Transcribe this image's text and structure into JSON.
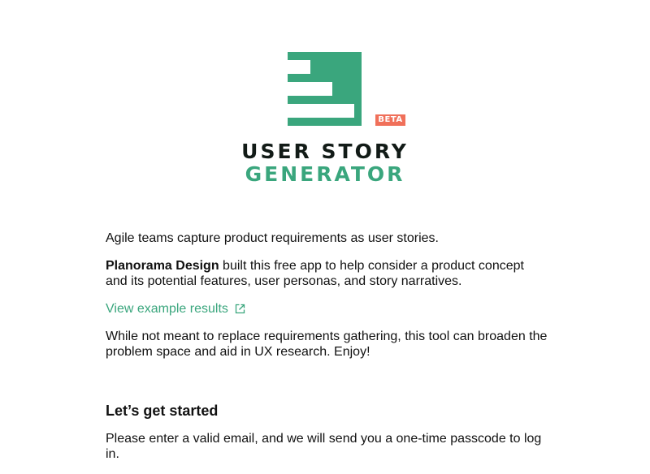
{
  "logo": {
    "badge": "BETA",
    "title_line1": "USER STORY",
    "title_line2": "GENERATOR",
    "brand_color": "#3aa67d",
    "badge_color": "#f0705a",
    "icon": "bars-logo-icon"
  },
  "intro": {
    "line1": "Agile teams capture product requirements as user stories.",
    "company_name": "Planorama Design",
    "line2_rest": " built this free app to help consider a product concept and its potential features, user personas, and story narratives.",
    "example_link": "View example results",
    "external_icon": "external-link-icon",
    "line3": "While not meant to replace requirements gathering, this tool can broaden the problem space and aid in UX research. Enjoy!"
  },
  "getting_started": {
    "title": "Let’s get started",
    "instructions": "Please enter a valid email, and we will send you a one-time passcode to log in."
  }
}
